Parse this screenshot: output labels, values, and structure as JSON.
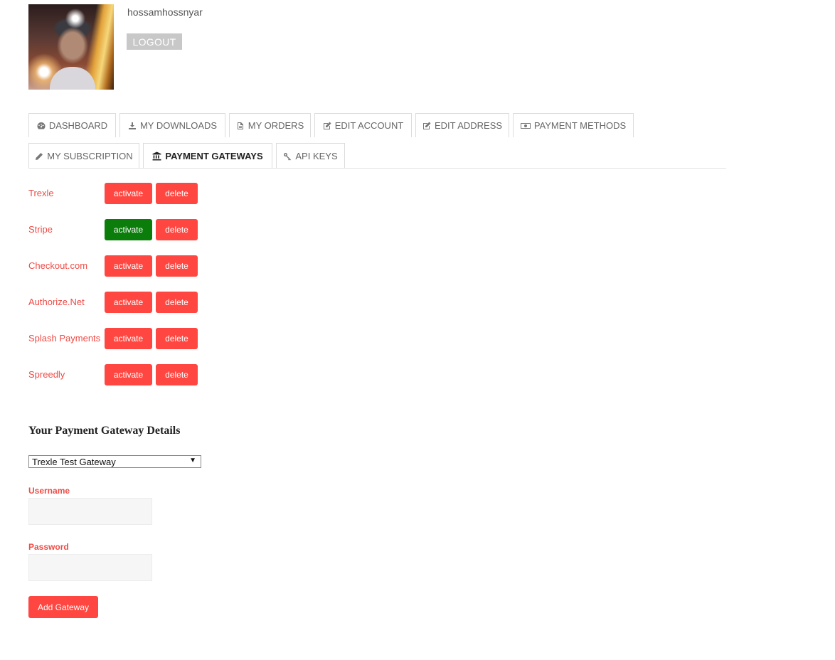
{
  "user": {
    "username": "hossamhossnyar",
    "logout_label": "LOGOUT"
  },
  "tabs": [
    {
      "label": "DASHBOARD",
      "icon": "dashboard-icon"
    },
    {
      "label": "MY DOWNLOADS",
      "icon": "download-icon"
    },
    {
      "label": "MY ORDERS",
      "icon": "file-icon"
    },
    {
      "label": "EDIT ACCOUNT",
      "icon": "edit-icon"
    },
    {
      "label": "EDIT ADDRESS",
      "icon": "edit-icon"
    },
    {
      "label": "PAYMENT METHODS",
      "icon": "money-icon"
    },
    {
      "label": "MY SUBSCRIPTION",
      "icon": "pencil-icon"
    },
    {
      "label": "PAYMENT GATEWAYS",
      "icon": "bank-icon",
      "active": true
    },
    {
      "label": "API KEYS",
      "icon": "key-icon"
    }
  ],
  "gateways": [
    {
      "name": "Trexle",
      "activate_label": "activate",
      "delete_label": "delete",
      "active": false
    },
    {
      "name": "Stripe",
      "activate_label": "activate",
      "delete_label": "delete",
      "active": true
    },
    {
      "name": "Checkout.com",
      "activate_label": "activate",
      "delete_label": "delete",
      "active": false
    },
    {
      "name": "Authorize.Net",
      "activate_label": "activate",
      "delete_label": "delete",
      "active": false
    },
    {
      "name": "Splash Payments",
      "activate_label": "activate",
      "delete_label": "delete",
      "active": false
    },
    {
      "name": "Spreedly",
      "activate_label": "activate",
      "delete_label": "delete",
      "active": false
    }
  ],
  "details": {
    "title": "Your Payment Gateway Details",
    "selected_gateway": "Trexle Test Gateway",
    "username_label": "Username",
    "username_value": "",
    "password_label": "Password",
    "password_value": "",
    "submit_label": "Add Gateway"
  },
  "colors": {
    "accent": "#ff4640",
    "active": "#0a7d0a",
    "link": "#ef4b46"
  }
}
